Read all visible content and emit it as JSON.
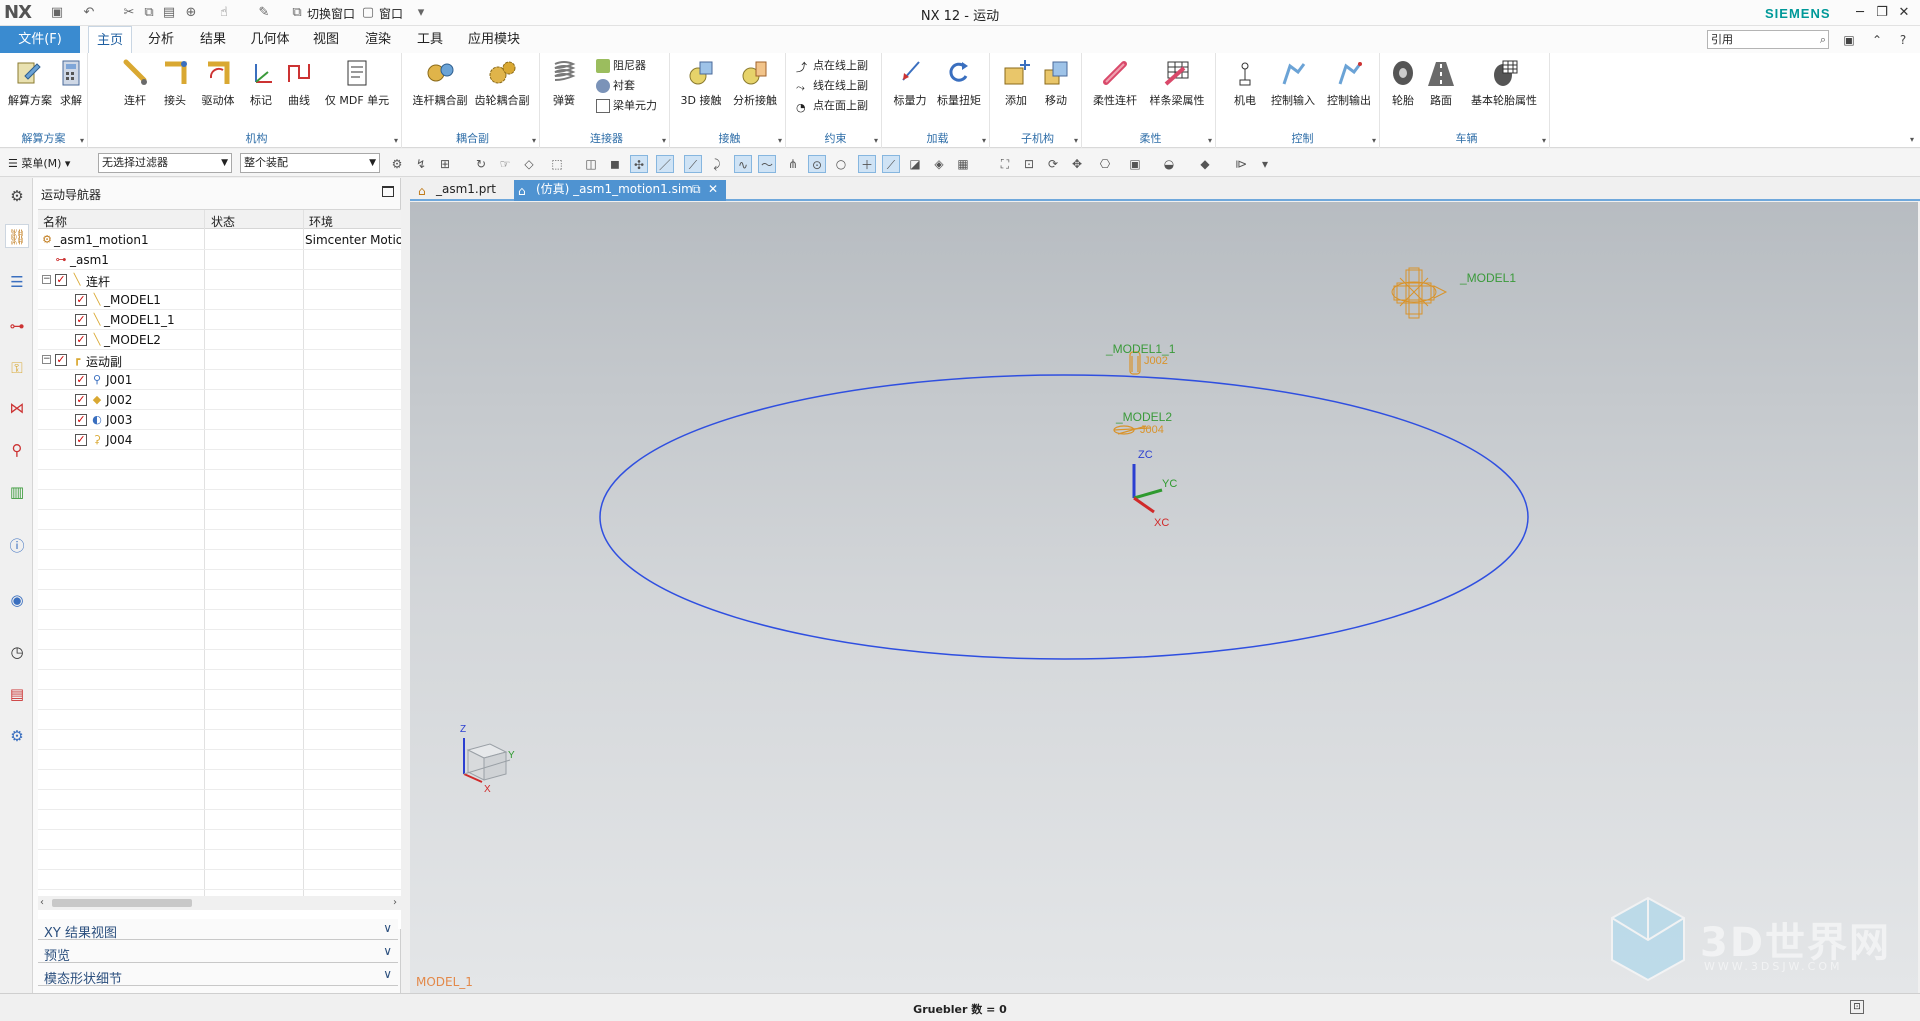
{
  "titlebar": {
    "logo": "NX",
    "switch_window": "切换窗口",
    "window_menu": "窗口",
    "title": "NX 12 - 运动",
    "brand": "SIEMENS"
  },
  "menu_tabs": {
    "file": "文件(F)",
    "tabs": [
      "主页",
      "分析",
      "结果",
      "几何体",
      "视图",
      "渲染",
      "工具",
      "应用模块"
    ],
    "active": "主页",
    "search_value": "引用"
  },
  "ribbon": {
    "groups": [
      {
        "label": "解算方案",
        "items": [
          "解算方案",
          "求解"
        ]
      },
      {
        "label": "机构",
        "items": [
          "连杆",
          "接头",
          "驱动体",
          "标记",
          "曲线",
          "仅 MDF 单元"
        ]
      },
      {
        "label": "耦合副",
        "items": [
          "连杆耦合副",
          "齿轮耦合副"
        ]
      },
      {
        "label": "连接器",
        "items": [
          "弹簧"
        ],
        "small_items": [
          "阻尼器",
          "衬套",
          "梁单元力"
        ]
      },
      {
        "label": "接触",
        "items": [
          "3D 接触",
          "分析接触"
        ]
      },
      {
        "label": "约束",
        "small_items": [
          "点在线上副",
          "线在线上副",
          "点在面上副"
        ]
      },
      {
        "label": "加载",
        "items": [
          "标量力",
          "标量扭矩"
        ]
      },
      {
        "label": "子机构",
        "items": [
          "添加",
          "移动"
        ]
      },
      {
        "label": "柔性",
        "items": [
          "柔性连杆",
          "样条梁属性"
        ]
      },
      {
        "label": "控制",
        "items": [
          "机电",
          "控制输入",
          "控制输出"
        ]
      },
      {
        "label": "车辆",
        "items": [
          "轮胎",
          "路面",
          "基本轮胎属性"
        ]
      }
    ]
  },
  "toolbar": {
    "menu": "菜单(M)",
    "filter": "无选择过滤器",
    "scope": "整个装配"
  },
  "navigator": {
    "title": "运动导航器",
    "columns": [
      "名称",
      "状态",
      "环境"
    ],
    "rows": [
      {
        "name": "_asm1_motion1",
        "env": "Simcenter Motion"
      },
      {
        "name": "_asm1",
        "env": ""
      },
      {
        "name": "连杆",
        "env": ""
      },
      {
        "name": "_MODEL1",
        "env": ""
      },
      {
        "name": "_MODEL1_1",
        "env": ""
      },
      {
        "name": "_MODEL2",
        "env": ""
      },
      {
        "name": "运动副",
        "env": ""
      },
      {
        "name": "J001",
        "env": ""
      },
      {
        "name": "J002",
        "env": ""
      },
      {
        "name": "J003",
        "env": ""
      },
      {
        "name": "J004",
        "env": ""
      }
    ],
    "accordions": [
      "XY 结果视图",
      "预览",
      "模态形状细节"
    ]
  },
  "doc_tabs": [
    {
      "label": "_asm1.prt"
    },
    {
      "label": "(仿真) _asm1_motion1.sim"
    }
  ],
  "graphics": {
    "labels": {
      "model1": "_MODEL1",
      "model1_1": "_MODEL1_1",
      "j002": "J002",
      "model2": "_MODEL2",
      "j004": "J004",
      "zc": "ZC",
      "yc": "YC",
      "xc": "XC",
      "z": "Z",
      "y": "Y",
      "x": "X",
      "bottom_label": "MODEL_1"
    },
    "watermark_main": "3D世界网",
    "watermark_sub": "WWW.3DSJW.COM",
    "colors": {
      "ellipse": "#2f4fe0",
      "model": "#d9932a",
      "label_green": "#3a9a3a",
      "background_top": "#b7bcc1",
      "background_bottom": "#e4e6e8"
    }
  },
  "status": {
    "text": "Gruebler 数 = 0"
  }
}
